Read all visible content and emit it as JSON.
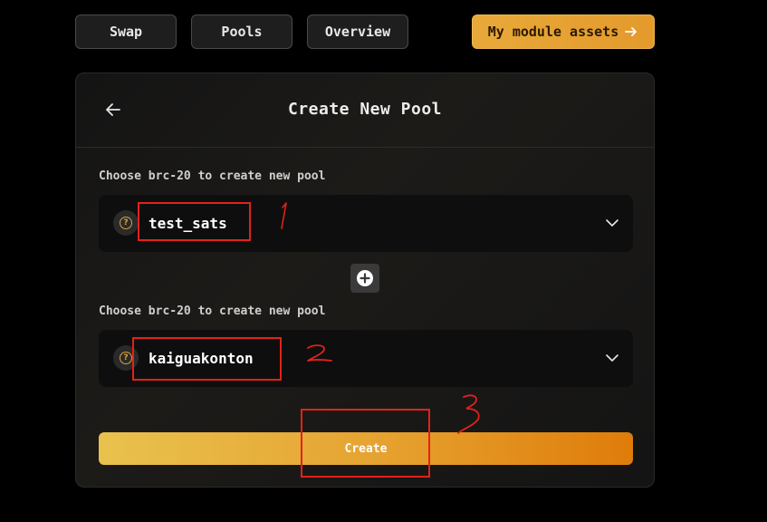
{
  "nav": {
    "swap_label": "Swap",
    "pools_label": "Pools",
    "overview_label": "Overview",
    "assets_label": "My module assets",
    "assets_icon": "arrow-right-icon"
  },
  "card": {
    "title": "Create New Pool",
    "back_icon": "arrow-left-icon"
  },
  "pool": {
    "first": {
      "label": "Choose brc-20 to create new pool",
      "token": "test_sats",
      "icon": "question-icon"
    },
    "second": {
      "label": "Choose brc-20 to create new pool",
      "token": "kaiguakonton",
      "icon": "question-icon"
    },
    "add_icon": "plus-circle-icon"
  },
  "actions": {
    "create_label": "Create"
  },
  "annotations": {
    "color": "#e3211a"
  },
  "colors": {
    "accent": "#e6a432",
    "background": "#000000",
    "card": "#161616"
  }
}
